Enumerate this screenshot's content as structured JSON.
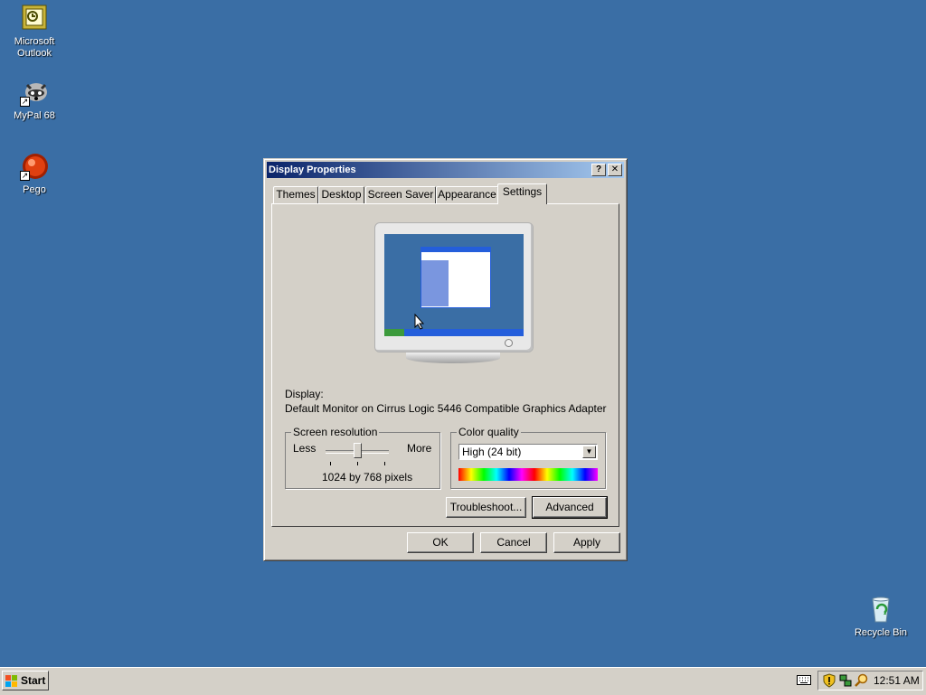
{
  "desktop": {
    "icons": [
      {
        "label_line1": "Microsoft",
        "label_line2": "Outlook",
        "icon": "outlook-icon"
      },
      {
        "label_line1": "MyPal 68",
        "label_line2": "",
        "icon": "raccoon-icon"
      },
      {
        "label_line1": "Pego",
        "label_line2": "",
        "icon": "pego-icon"
      },
      {
        "label_line1": "Recycle Bin",
        "label_line2": "",
        "icon": "recycle-bin-icon"
      }
    ]
  },
  "dialog": {
    "title": "Display Properties",
    "help_glyph": "?",
    "close_glyph": "✕",
    "tabs": [
      "Themes",
      "Desktop",
      "Screen Saver",
      "Appearance",
      "Settings"
    ],
    "active_tab": "Settings",
    "display_label": "Display:",
    "display_value": "Default Monitor on Cirrus Logic 5446 Compatible Graphics Adapter",
    "resolution": {
      "group_title": "Screen resolution",
      "less": "Less",
      "more": "More",
      "value_text": "1024 by 768 pixels"
    },
    "color": {
      "group_title": "Color quality",
      "selected": "High (24 bit)"
    },
    "buttons": {
      "troubleshoot": "Troubleshoot...",
      "advanced": "Advanced",
      "ok": "OK",
      "cancel": "Cancel",
      "apply": "Apply"
    }
  },
  "taskbar": {
    "start_label": "Start",
    "clock": "12:51 AM"
  },
  "colors": {
    "desktop": "#3a6ea5",
    "title_active": "#0a246a"
  }
}
